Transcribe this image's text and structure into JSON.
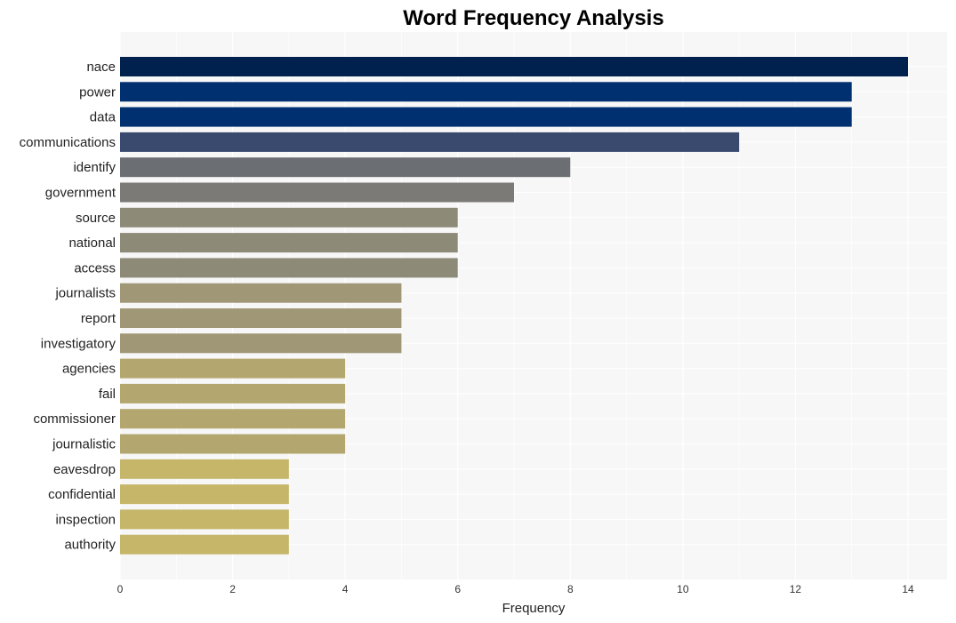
{
  "chart_data": {
    "type": "bar",
    "orientation": "horizontal",
    "title": "Word Frequency Analysis",
    "xlabel": "Frequency",
    "ylabel": "",
    "xlim": [
      0,
      14.7
    ],
    "xticks": [
      0,
      2,
      4,
      6,
      8,
      10,
      12,
      14
    ],
    "grid": true,
    "categories": [
      "nace",
      "power",
      "data",
      "communications",
      "identify",
      "government",
      "source",
      "national",
      "access",
      "journalists",
      "report",
      "investigatory",
      "agencies",
      "fail",
      "commissioner",
      "journalistic",
      "eavesdrop",
      "confidential",
      "inspection",
      "authority"
    ],
    "values": [
      14,
      13,
      13,
      11,
      8,
      7,
      6,
      6,
      6,
      5,
      5,
      5,
      4,
      4,
      4,
      4,
      3,
      3,
      3,
      3
    ],
    "colors": [
      "#00204e",
      "#00306f",
      "#00306f",
      "#3a4a6f",
      "#6b6e72",
      "#7b7a77",
      "#8e8a78",
      "#8e8a78",
      "#8e8a78",
      "#a09776",
      "#a09776",
      "#a09776",
      "#b3a76f",
      "#b3a76f",
      "#b3a76f",
      "#b3a76f",
      "#c5b66a",
      "#c5b66a",
      "#c5b66a",
      "#c5b66a"
    ]
  }
}
